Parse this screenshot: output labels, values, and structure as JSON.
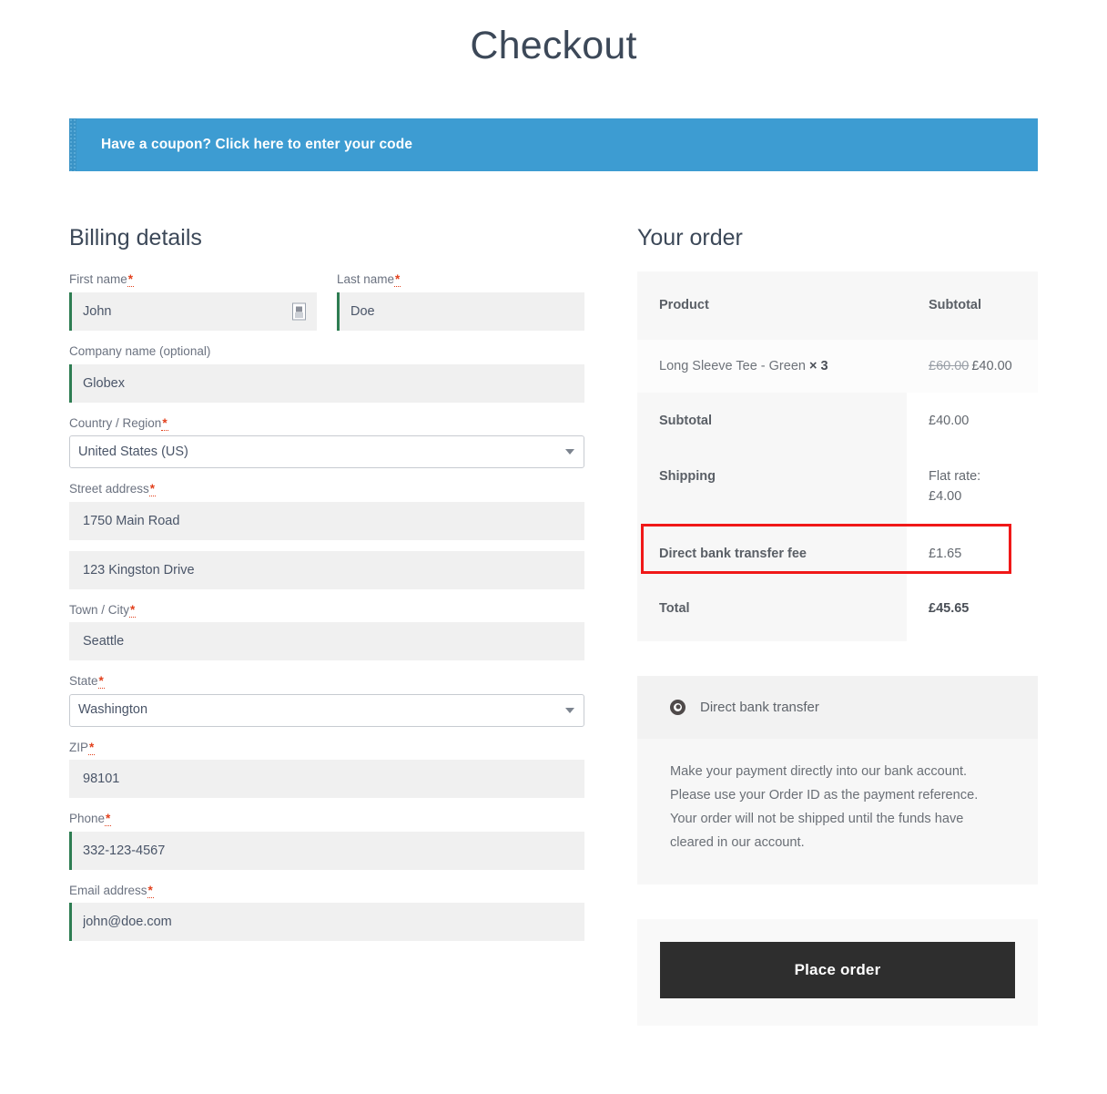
{
  "page": {
    "title": "Checkout"
  },
  "coupon": {
    "link_text": "Have a coupon? Click here to enter your code"
  },
  "billing": {
    "heading": "Billing details",
    "required_mark": "*",
    "fields": [
      {
        "label": "First name",
        "value": "John",
        "required": true,
        "valid": true
      },
      {
        "label": "Last name",
        "value": "Doe",
        "required": true,
        "valid": true
      },
      {
        "label": "Company name (optional)",
        "value": "Globex",
        "required": false,
        "valid": true
      },
      {
        "label": "Country / Region",
        "value": "United States (US)",
        "required": true,
        "type": "select"
      },
      {
        "label": "Street address",
        "value": "1750 Main Road",
        "required": true,
        "valid": false
      },
      {
        "label": "",
        "value": "123 Kingston Drive",
        "required": false,
        "valid": false
      },
      {
        "label": "Town / City",
        "value": "Seattle",
        "required": true,
        "valid": false
      },
      {
        "label": "State",
        "value": "Washington",
        "required": true,
        "type": "select"
      },
      {
        "label": "ZIP",
        "value": "98101",
        "required": true,
        "valid": false
      },
      {
        "label": "Phone",
        "value": "332-123-4567",
        "required": true,
        "valid": true
      },
      {
        "label": "Email address",
        "value": "john@doe.com",
        "required": true,
        "valid": true
      }
    ]
  },
  "order": {
    "heading": "Your order",
    "columns": {
      "product": "Product",
      "subtotal": "Subtotal"
    },
    "line_item": {
      "name": "Long Sleeve Tee - Green",
      "quantity": "× 3",
      "original_price": "£60.00",
      "price": "£40.00"
    },
    "rows": {
      "subtotal_label": "Subtotal",
      "subtotal_value": "£40.00",
      "shipping_label": "Shipping",
      "shipping_value": "Flat rate: £4.00",
      "shipping_value_line1": "Flat rate:",
      "shipping_value_line2": "£4.00",
      "fee_label": "Direct bank transfer fee",
      "fee_value": "£1.65",
      "total_label": "Total",
      "total_value": "£45.65"
    },
    "highlight_color": "#f01818"
  },
  "payment": {
    "method_label": "Direct bank transfer",
    "method_selected": true,
    "description": "Make your payment directly into our bank account. Please use your Order ID as the payment reference. Your order will not be shipped until the funds have cleared in our account.",
    "place_order_label": "Place order"
  },
  "colors": {
    "coupon_bar": "#3d9cd2",
    "valid_border": "#2e7d52",
    "required_star": "#e2401c",
    "button": "#2e2e2e"
  }
}
